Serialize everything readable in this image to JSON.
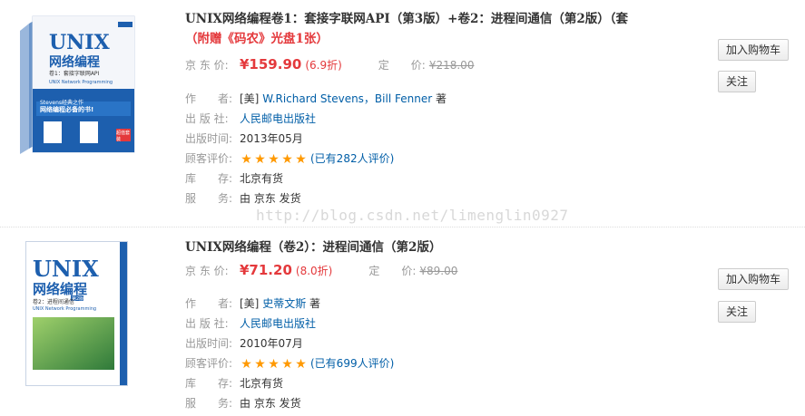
{
  "watermark": "http://blog.csdn.net/limenglin0927",
  "items": [
    {
      "title": "UNIX网络编程卷1：套接字联网API（第3版）+卷2：进程间通信（第2版）（套",
      "promo": "（附赠《码农》光盘1张）",
      "price_label": "京 东 价:",
      "price": "¥159.90",
      "discount": "(6.9折)",
      "orig_label": "定　　价:",
      "orig_price": "¥218.00",
      "author_label": "作　　者:",
      "author_prefix": "[美]",
      "author_names": "W.Richard Stevens，Bill Fenner",
      "author_suffix": "著",
      "publisher_label": "出 版 社:",
      "publisher": "人民邮电出版社",
      "date_label": "出版时间:",
      "date": "2013年05月",
      "rating_label": "顾客评价:",
      "rating_stars": 5,
      "rating_text": "(已有282人评价)",
      "stock_label": "库　　存:",
      "stock": "北京有货",
      "service_label": "服　　务:",
      "service": "由 京东 发货",
      "add_cart": "加入购物车",
      "follow": "关注",
      "cover": {
        "brand": "UNIX",
        "subtitle": "网络编程",
        "vol": "卷1：套接字联网API",
        "en_title": "UNIX Network Programming",
        "banner_line1": "Stevens经典之作",
        "banner_line2": "网络编程必备的书!",
        "badge": "超值套装"
      }
    },
    {
      "title": "UNIX网络编程（卷2）：进程间通信（第2版）",
      "price_label": "京 东 价:",
      "price": "¥71.20",
      "discount": "(8.0折)",
      "orig_label": "定　　价:",
      "orig_price": "¥89.00",
      "author_label": "作　　者:",
      "author_prefix": "[美]",
      "author_names": "史蒂文斯",
      "author_suffix": "著",
      "publisher_label": "出 版 社:",
      "publisher": "人民邮电出版社",
      "date_label": "出版时间:",
      "date": "2010年07月",
      "rating_label": "顾客评价:",
      "rating_stars": 5,
      "rating_text": "(已有699人评价)",
      "stock_label": "库　　存:",
      "stock": "北京有货",
      "service_label": "服　　务:",
      "service": "由 京东 发货",
      "add_cart": "加入购物车",
      "follow": "关注",
      "cover": {
        "brand": "UNIX",
        "subtitle": "网络编程",
        "vol": "卷2：进程间通信",
        "edition": "第2版",
        "en_title": "UNIX Network Programming"
      }
    }
  ],
  "colors": {
    "price": "#e4393c",
    "link": "#005ea7",
    "star": "#ff9900",
    "cover_blue": "#1d5fae"
  },
  "icons": {
    "star": "star-icon"
  }
}
